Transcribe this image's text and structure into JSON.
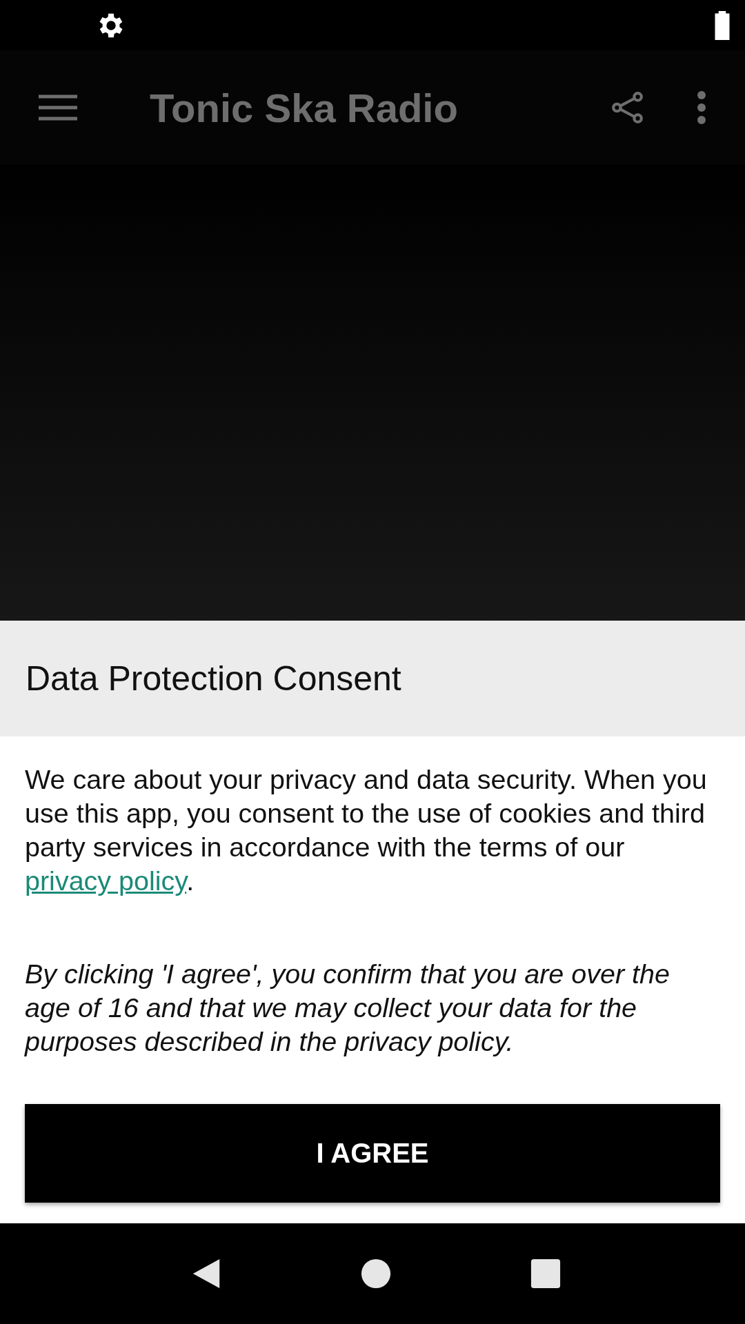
{
  "app_bar": {
    "title": "Tonic Ska Radio"
  },
  "consent": {
    "title": "Data Protection Consent",
    "text_before": "We care about your privacy and data security. When you use this app, you consent to the use of cookies and third party services in accordance with the terms of our ",
    "link": "privacy policy",
    "text_after": ".",
    "note": "By clicking 'I agree', you confirm that you are over the age of 16 and that we may collect your data for the purposes described in the privacy policy.",
    "button": "I AGREE"
  }
}
